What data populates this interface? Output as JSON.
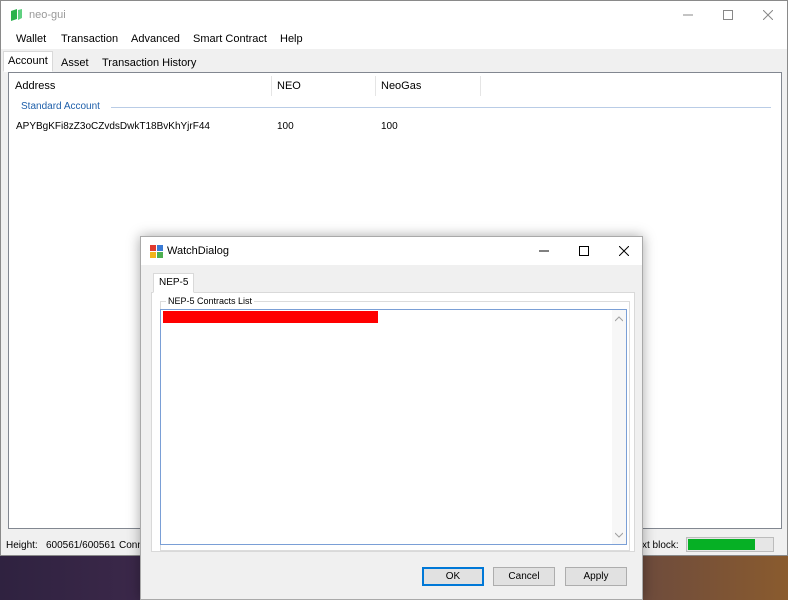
{
  "app": {
    "title": "neo-gui"
  },
  "menu": [
    "Wallet",
    "Transaction",
    "Advanced",
    "Smart Contract",
    "Help"
  ],
  "tabs": [
    "Account",
    "Asset",
    "Transaction History"
  ],
  "account_list": {
    "columns": [
      "Address",
      "NEO",
      "NeoGas"
    ],
    "group": "Standard Account",
    "rows": [
      {
        "address": "APYBgKFi8zZ3oCZvdsDwkT18BvKhYjrF44",
        "neo": "100",
        "neogas": "100"
      }
    ]
  },
  "status": {
    "height_label": "Height:",
    "height_value": "600561/600561",
    "connected_fragment": "Conn",
    "next_block_fragment": "xt block:",
    "sync_progress_fraction": 0.8
  },
  "dialog": {
    "title": "WatchDialog",
    "tab": "NEP-5",
    "group_label": "NEP-5 Contracts List",
    "buttons": {
      "ok": "OK",
      "cancel": "Cancel",
      "apply": "Apply"
    }
  },
  "colors": {
    "progress": "#06b025",
    "highlight": "#ff0000",
    "group_header": "#1e5faa",
    "app_icon": "#2bb24c"
  }
}
